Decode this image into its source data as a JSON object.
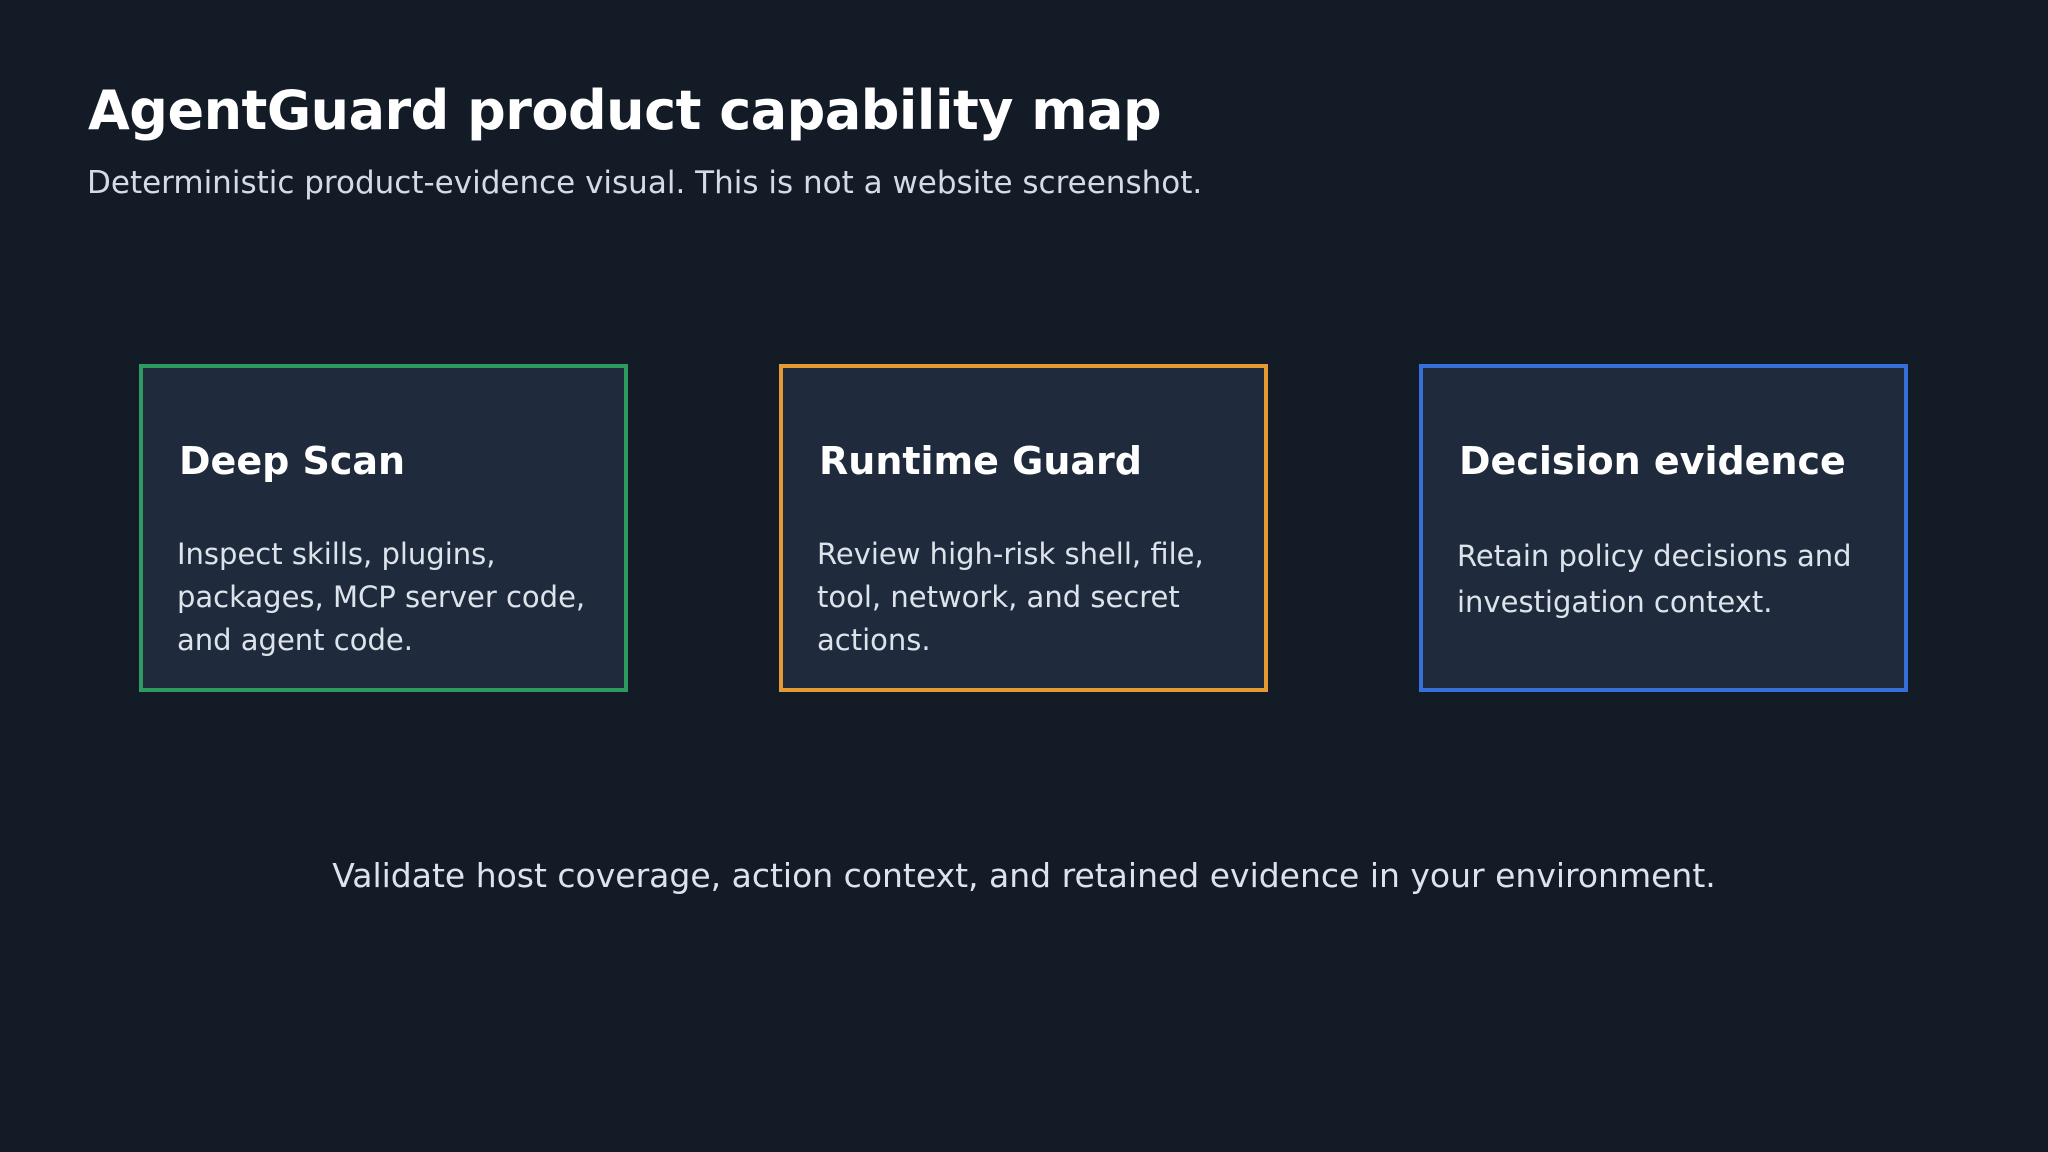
{
  "header": {
    "title": "AgentGuard product capability map",
    "subtitle": "Deterministic product-evidence visual. This is not a website screenshot."
  },
  "cards": [
    {
      "title": "Deep Scan",
      "body": "Inspect skills, plugins, packages, MCP server code, and agent code.",
      "border_color": "#2e9a62"
    },
    {
      "title": "Runtime Guard",
      "body": "Review high-risk shell, file, tool, network, and secret actions.",
      "border_color": "#e59b33"
    },
    {
      "title": "Decision evidence",
      "body": "Retain policy decisions and investigation context.",
      "border_color": "#3670d9"
    }
  ],
  "footer": {
    "note": "Validate host coverage, action context, and retained evidence in your environment."
  },
  "colors": {
    "background": "#131b27",
    "card_background": "#1f2b3c"
  }
}
